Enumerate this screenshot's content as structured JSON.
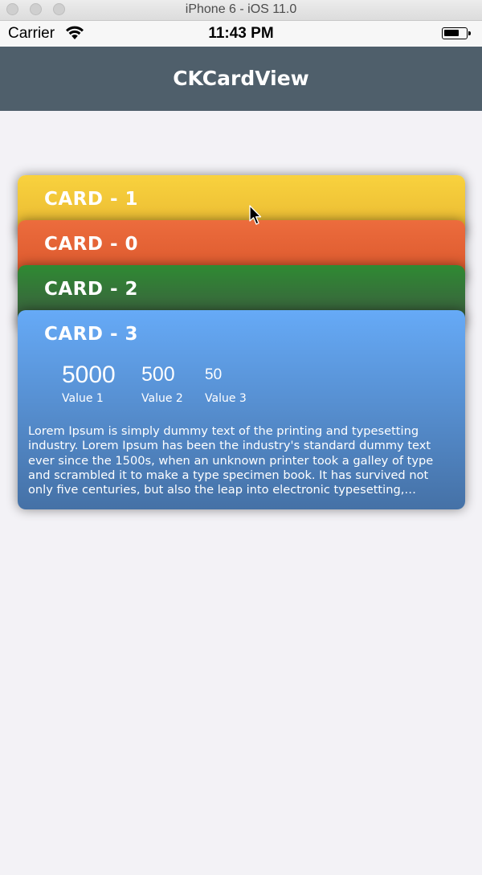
{
  "simulator": {
    "title": "iPhone 6 - iOS 11.0"
  },
  "statusbar": {
    "carrier": "Carrier",
    "time": "11:43 PM"
  },
  "navbar": {
    "title": "CKCardView"
  },
  "cards": [
    {
      "title": "CARD - 1",
      "color": "#f9d23e"
    },
    {
      "title": "CARD - 0",
      "color": "#ec6c3d"
    },
    {
      "title": "CARD - 2",
      "color": "#2f8a33"
    },
    {
      "title": "CARD - 3",
      "color": "#66aaf7",
      "values": [
        {
          "value": "5000",
          "label": "Value 1"
        },
        {
          "value": "500",
          "label": "Value 2"
        },
        {
          "value": "50",
          "label": "Value 3"
        }
      ],
      "description": "Lorem Ipsum is simply dummy text of the printing and typesetting industry. Lorem Ipsum has been the industry's standard dummy text ever since the 1500s, when an unknown printer took a galley of type and scrambled it to make a type specimen book. It has survived not only five centuries, but also the leap into electronic typesetting, remaining essentially unchanged."
    }
  ],
  "icons": [
    "wifi-icon",
    "battery-icon",
    "mouse-cursor-icon"
  ]
}
